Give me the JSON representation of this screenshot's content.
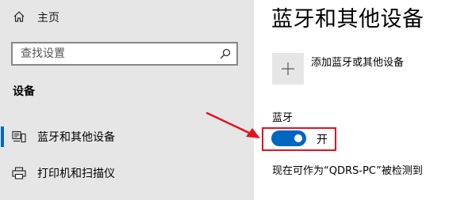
{
  "sidebar": {
    "home": {
      "label": "主页",
      "icon": "home-icon"
    },
    "search": {
      "placeholder": "查找设置",
      "value": "",
      "icon": "search-icon"
    },
    "section_title": "设备",
    "items": [
      {
        "label": "蓝牙和其他设备",
        "icon": "bluetooth-devices-icon",
        "active": true
      },
      {
        "label": "打印机和扫描仪",
        "icon": "printer-icon",
        "active": false
      }
    ]
  },
  "main": {
    "title": "蓝牙和其他设备",
    "add_device": {
      "label": "添加蓝牙或其他设备",
      "icon": "plus-icon"
    },
    "bluetooth": {
      "label": "蓝牙",
      "toggle_on": true,
      "state_text": "开"
    },
    "discoverable_text": "现在可作为“QDRS-PC”被检测到"
  },
  "annotation": {
    "arrow_color": "#e0141e",
    "highlight_color": "#e0141e"
  },
  "colors": {
    "accent": "#0067c0",
    "sidebar_bg": "#e6e6e6",
    "content_bg": "#ffffff"
  }
}
